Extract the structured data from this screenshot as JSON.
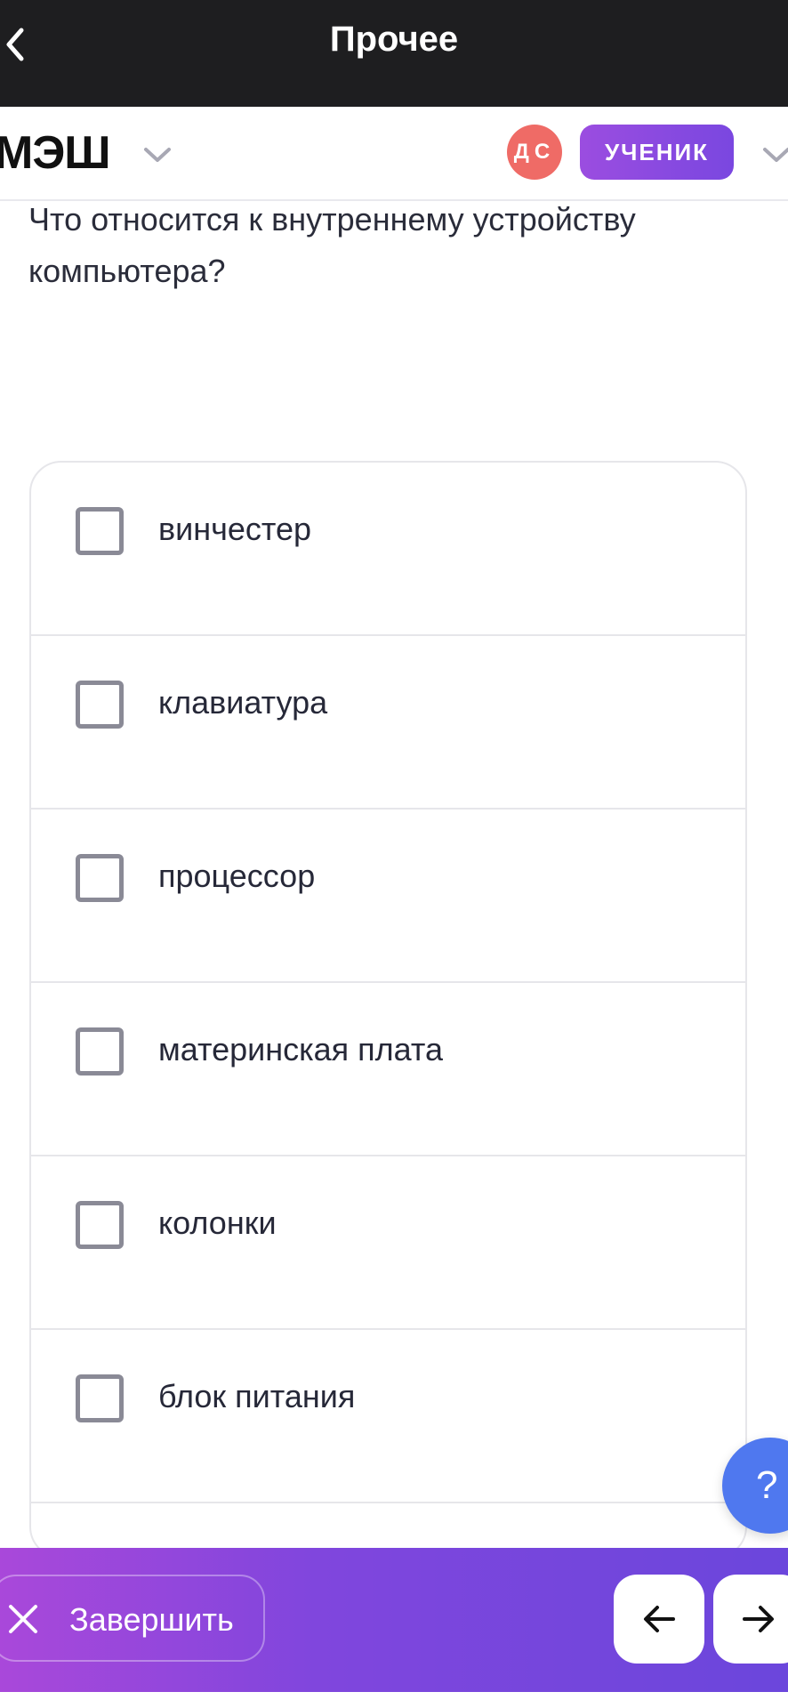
{
  "topbar": {
    "title": "Прочее"
  },
  "header": {
    "logo": "МЭШ",
    "avatar_initials": "ДС",
    "role_label": "УЧЕНИК"
  },
  "question": {
    "text": "Что относится к внутреннему устройству компьютера?"
  },
  "options": [
    {
      "label": "винчестер",
      "checked": false
    },
    {
      "label": "клавиатура",
      "checked": false
    },
    {
      "label": "процессор",
      "checked": false
    },
    {
      "label": "материнская плата",
      "checked": false
    },
    {
      "label": "колонки",
      "checked": false
    },
    {
      "label": "блок питания",
      "checked": false
    }
  ],
  "help": {
    "label": "?"
  },
  "bottombar": {
    "finish_label": "Завершить",
    "prev_icon": "arrow-left-icon",
    "next_icon": "arrow-right-icon"
  },
  "colors": {
    "topbar": "#1e1e20",
    "accent_purple": "#7a47e0",
    "avatar": "#ef6b66",
    "help": "#4f78ef"
  }
}
